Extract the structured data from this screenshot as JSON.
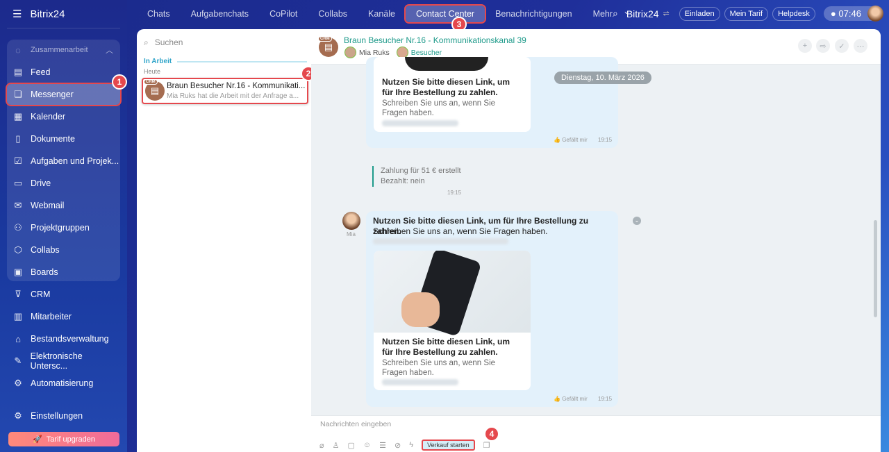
{
  "sidebar": {
    "brand": "Bitrix24",
    "group": "Zusammenarbeit",
    "items": [
      {
        "label": "Feed",
        "icon": "feed-icon"
      },
      {
        "label": "Messenger",
        "icon": "messenger-icon"
      },
      {
        "label": "Kalender",
        "icon": "calendar-icon"
      },
      {
        "label": "Dokumente",
        "icon": "document-icon"
      },
      {
        "label": "Aufgaben und Projek...",
        "icon": "tasks-icon"
      },
      {
        "label": "Drive",
        "icon": "drive-icon"
      },
      {
        "label": "Webmail",
        "icon": "mail-icon"
      },
      {
        "label": "Projektgruppen",
        "icon": "groups-icon"
      },
      {
        "label": "Collabs",
        "icon": "collabs-icon"
      },
      {
        "label": "Boards",
        "icon": "boards-icon"
      },
      {
        "label": "CRM",
        "icon": "crm-icon"
      },
      {
        "label": "Mitarbeiter",
        "icon": "employees-icon"
      },
      {
        "label": "Bestandsverwaltung",
        "icon": "inventory-icon"
      },
      {
        "label": "Elektronische Untersc...",
        "icon": "signature-icon"
      },
      {
        "label": "Automatisierung",
        "icon": "automation-icon"
      }
    ],
    "settings": "Einstellungen",
    "upgrade": "Tarif upgraden"
  },
  "topnav": {
    "tabs": [
      "Chats",
      "Aufgabenchats",
      "CoPilot",
      "Collabs",
      "Kanäle",
      "Contact Center",
      "Benachrichtigungen",
      "Mehr"
    ],
    "brand": "Bitrix24",
    "buttons": [
      "Einladen",
      "Mein Tarif",
      "Helpdesk"
    ],
    "time": "07:46"
  },
  "badges": [
    "1",
    "2",
    "3",
    "4"
  ],
  "list": {
    "search_placeholder": "Suchen",
    "section": "In Arbeit",
    "date_group": "Heute",
    "item": {
      "tag": "CRM",
      "title": "Braun Besucher Nr.16 - Kommunikati...",
      "preview": "Mia Ruks hat die Arbeit mit der Anfrage a..."
    }
  },
  "chat": {
    "title": "Braun Besucher Nr.16 - Kommunikationskanal 39",
    "tag": "CRM",
    "participants": [
      "Mia Ruks",
      "Besucher"
    ],
    "date_pill": "Dienstag, 10. März 2026",
    "card_title": "Nutzen Sie bitte diesen Link, um für Ihre Bestellung zu zahlen.",
    "card_sub": "Schreiben Sie uns an, wenn Sie Fragen haben.",
    "like": "Gefällt mir",
    "time": "19:15",
    "system": {
      "line1": "Zahlung für 51 € erstellt",
      "line2": "Bezahlt: nein",
      "time": "19:15"
    },
    "msg": {
      "author": "Mia",
      "title": "Nutzen Sie bitte diesen Link, um für Ihre Bestellung zu zahlen.",
      "sub": "Schreiben Sie uns an, wenn Sie Fragen haben."
    },
    "input_placeholder": "Nachrichten eingeben",
    "sale_button": "Verkauf starten"
  }
}
